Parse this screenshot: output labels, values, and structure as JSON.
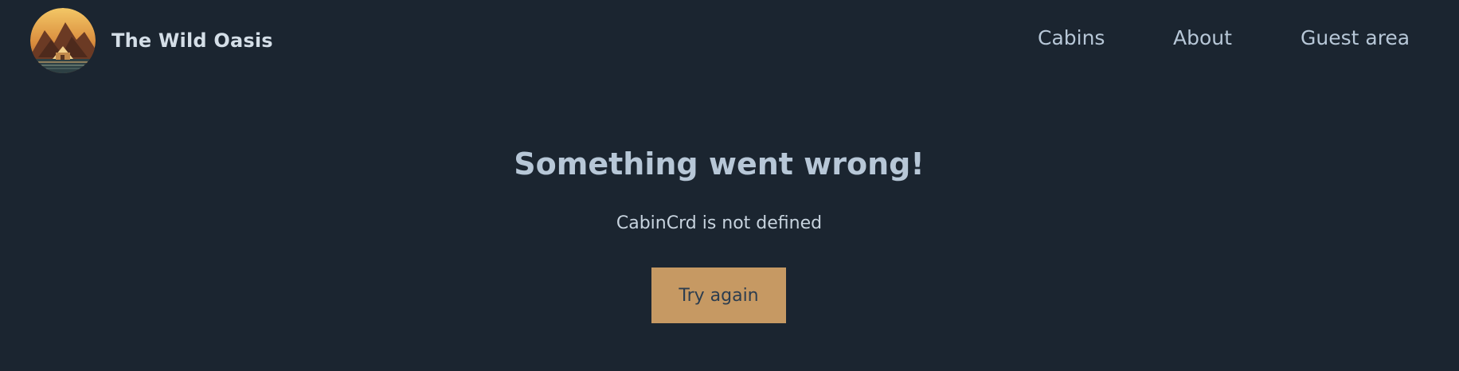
{
  "header": {
    "brand_name": "The Wild Oasis",
    "nav": [
      {
        "label": "Cabins"
      },
      {
        "label": "About"
      },
      {
        "label": "Guest area"
      }
    ]
  },
  "error": {
    "title": "Something went wrong!",
    "message": "CabinCrd is not defined",
    "retry_label": "Try again"
  },
  "colors": {
    "background": "#1b2530",
    "accent": "#c69963",
    "text_primary": "#b7c7d7"
  }
}
